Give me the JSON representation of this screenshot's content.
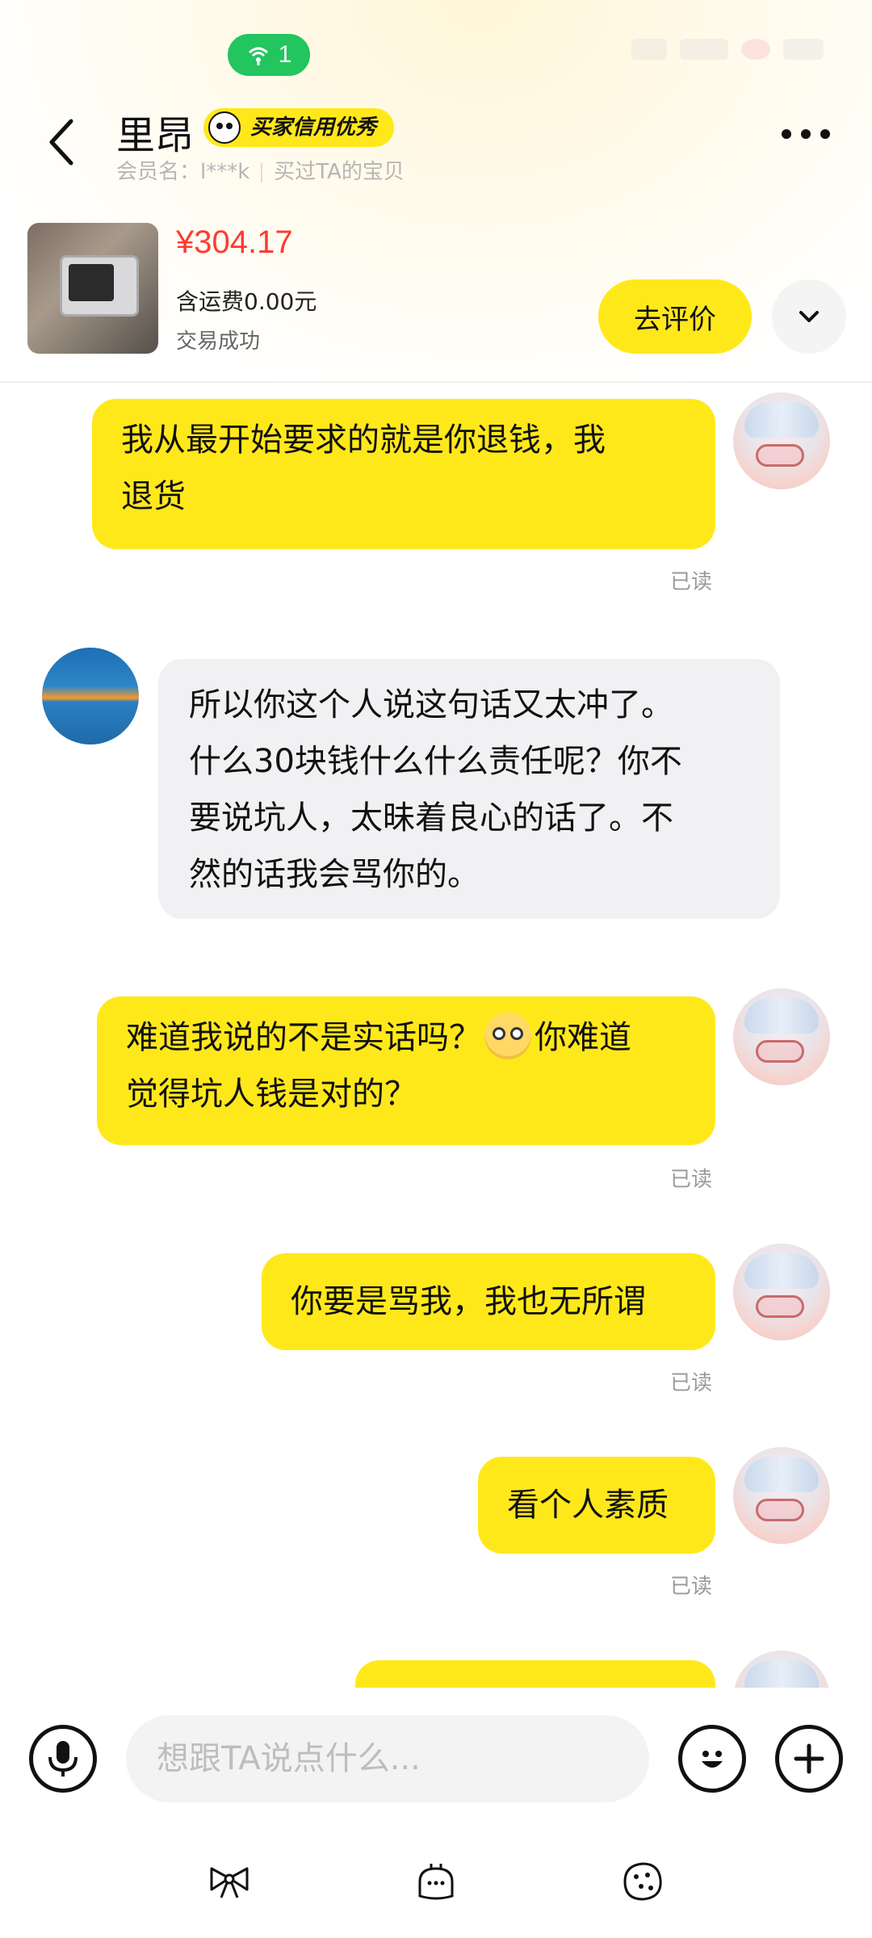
{
  "status_bar": {
    "hotspot_count": "1"
  },
  "header": {
    "contact_name": "里昂",
    "credit_badge": "买家信用优秀",
    "member_label": "会员名：l***k",
    "bought_label": "买过TA的宝贝"
  },
  "order": {
    "price": "¥304.17",
    "shipping": "含运费0.00元",
    "status": "交易成功",
    "review_button": "去评价"
  },
  "messages": [
    {
      "from": "me",
      "text": "我从最开始要求的就是你退钱，我退货",
      "line1": "我从最开始要求的就是你退钱，我",
      "line2": "退货",
      "read": "已读"
    },
    {
      "from": "them",
      "lines": [
        "所以你这个人说这句话又太冲了。",
        "什么30块钱什么什么责任呢？你不",
        "要说坑人，太昧着良心的话了。不",
        "然的话我会骂你的。"
      ]
    },
    {
      "from": "me",
      "part1": "难道我说的不是实话吗？",
      "part2": "你难道",
      "line2": "觉得坑人钱是对的？",
      "read": "已读"
    },
    {
      "from": "me",
      "text": "你要是骂我，我也无所谓",
      "read": "已读"
    },
    {
      "from": "me",
      "text": "看个人素质",
      "read": "已读"
    }
  ],
  "composer": {
    "placeholder": "想跟TA说点什么..."
  },
  "icons": [
    "back-icon",
    "more-icon",
    "chevron-down-icon",
    "microphone-icon",
    "smiley-icon",
    "plus-icon",
    "bow-icon",
    "cake-icon",
    "cookie-icon"
  ]
}
